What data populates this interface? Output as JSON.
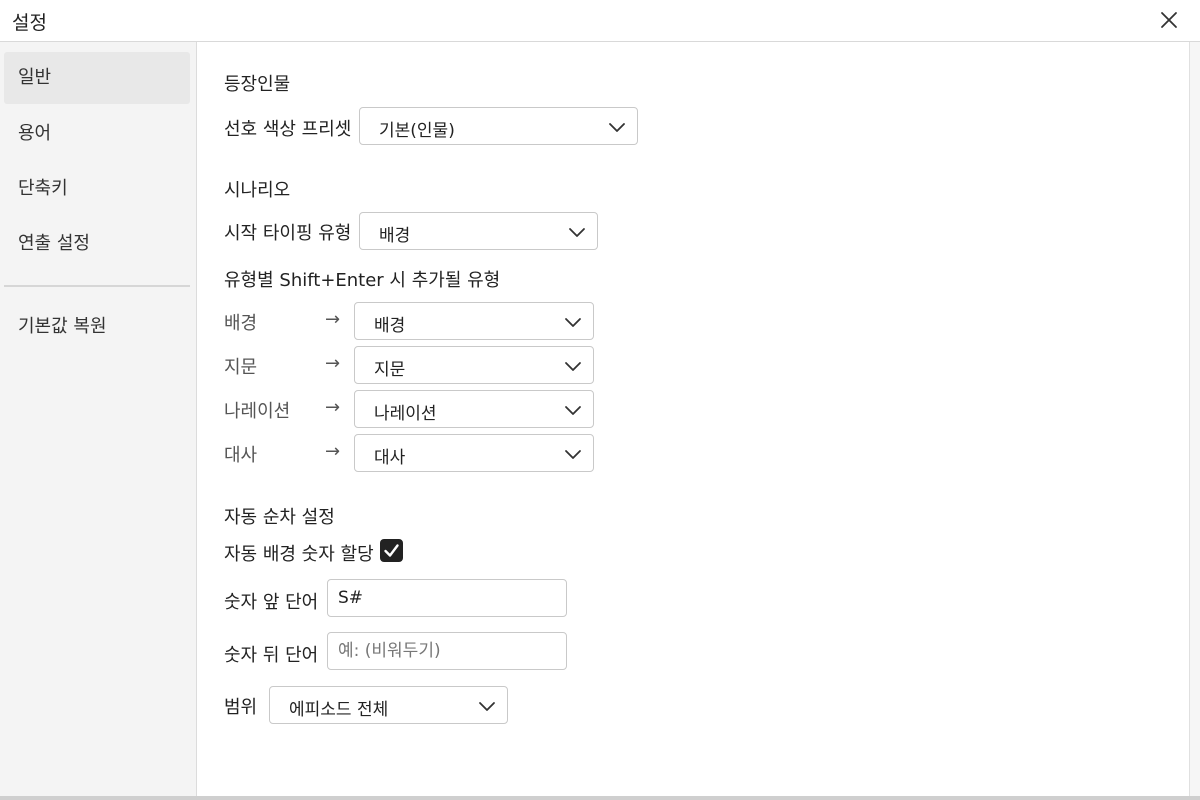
{
  "window": {
    "title": "설정"
  },
  "sidebar": {
    "items": [
      {
        "label": "일반",
        "active": true
      },
      {
        "label": "용어"
      },
      {
        "label": "단축키"
      },
      {
        "label": "연출 설정"
      }
    ],
    "reset_label": "기본값 복원"
  },
  "characters": {
    "title": "등장인물",
    "preset_label": "선호 색상 프리셋",
    "preset_value": "기본(인물)"
  },
  "scenario": {
    "title": "시나리오",
    "typing_label": "시작 타이핑 유형",
    "typing_value": "배경",
    "shift_enter_title": "유형별 Shift+Enter 시 추가될 유형",
    "arrow": "→",
    "mappings": [
      {
        "from": "배경",
        "to": "배경"
      },
      {
        "from": "지문",
        "to": "지문"
      },
      {
        "from": "나레이션",
        "to": "나레이션"
      },
      {
        "from": "대사",
        "to": "대사"
      }
    ]
  },
  "auto_numbering": {
    "title": "자동 순차 설정",
    "auto_label": "자동 배경 숫자 할당",
    "auto_checked": true,
    "prefix_label": "숫자 앞 단어",
    "prefix_value": "S#",
    "suffix_label": "숫자 뒤 단어",
    "suffix_placeholder": "예: (비워두기)",
    "scope_label": "범위",
    "scope_value": "에피소드 전체"
  }
}
